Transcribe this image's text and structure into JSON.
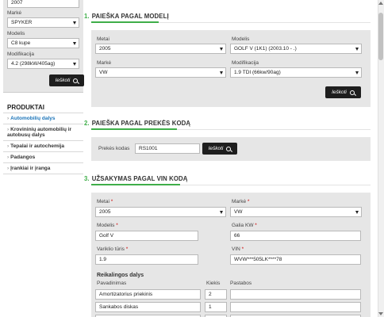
{
  "sidebar": {
    "year_value": "2007",
    "make_label": "Markė",
    "make_value": "SPYKER",
    "model_label": "Modelis",
    "model_value": "C8 kupe",
    "mod_label": "Modifikacija",
    "mod_value": "4.2 (298kW/405ag)",
    "search_label": "Ieškoti",
    "products_title": "PRODUKTAI",
    "items": [
      {
        "label": "Automobilių dalys"
      },
      {
        "label": "Krovininių automobilių ir autobusų dalys"
      },
      {
        "label": "Tepalai ir autochemija"
      },
      {
        "label": "Padangos"
      },
      {
        "label": "Įrankiai ir įranga"
      }
    ]
  },
  "section1": {
    "num": "1.",
    "title": "PAIEŠKA PAGAL MODELĮ",
    "year_label": "Metai",
    "year_value": "2005",
    "model_label": "Modelis",
    "model_value": "GOLF V (1K1) (2003.10 - .)",
    "make_label": "Markė",
    "make_value": "VW",
    "mod_label": "Modifikacija",
    "mod_value": "1.9 TDI (66kw/90ag)",
    "search_label": "Ieškoti"
  },
  "section2": {
    "num": "2.",
    "title": "PAIEŠKA PAGAL PREKĖS KODĄ",
    "code_label": "Prekės kodas",
    "code_value": "RS1001",
    "search_label": "Ieškoti"
  },
  "section3": {
    "num": "3.",
    "title": "UŽSAKYMAS PAGAL VIN KODĄ",
    "required_mark": "*",
    "year_label": "Metai",
    "year_value": "2005",
    "make_label": "Markė",
    "make_value": "VW",
    "model_label": "Modelis",
    "model_value": "Golf V",
    "power_label": "Galia KW",
    "power_value": "66",
    "engine_label": "Variklio tūris",
    "engine_value": "1.9",
    "vin_label": "VIN",
    "vin_value": "WVW***505LK****78",
    "parts_title": "Reikalingos dalys",
    "col_name": "Pavadinimas",
    "col_qty": "Kiekis",
    "col_note": "Pastabos",
    "rows": [
      {
        "name": "Amortizatorius priekinis",
        "qty": "2",
        "note": ""
      },
      {
        "name": "Sankabos diskas",
        "qty": "1",
        "note": ""
      },
      {
        "name": "",
        "qty": "",
        "note": ""
      }
    ]
  },
  "colors": {
    "accent_green": "#3fae49",
    "link_blue": "#1a73b8",
    "button_dark": "#1e1e1e",
    "panel_grey": "#e6e6e6"
  }
}
